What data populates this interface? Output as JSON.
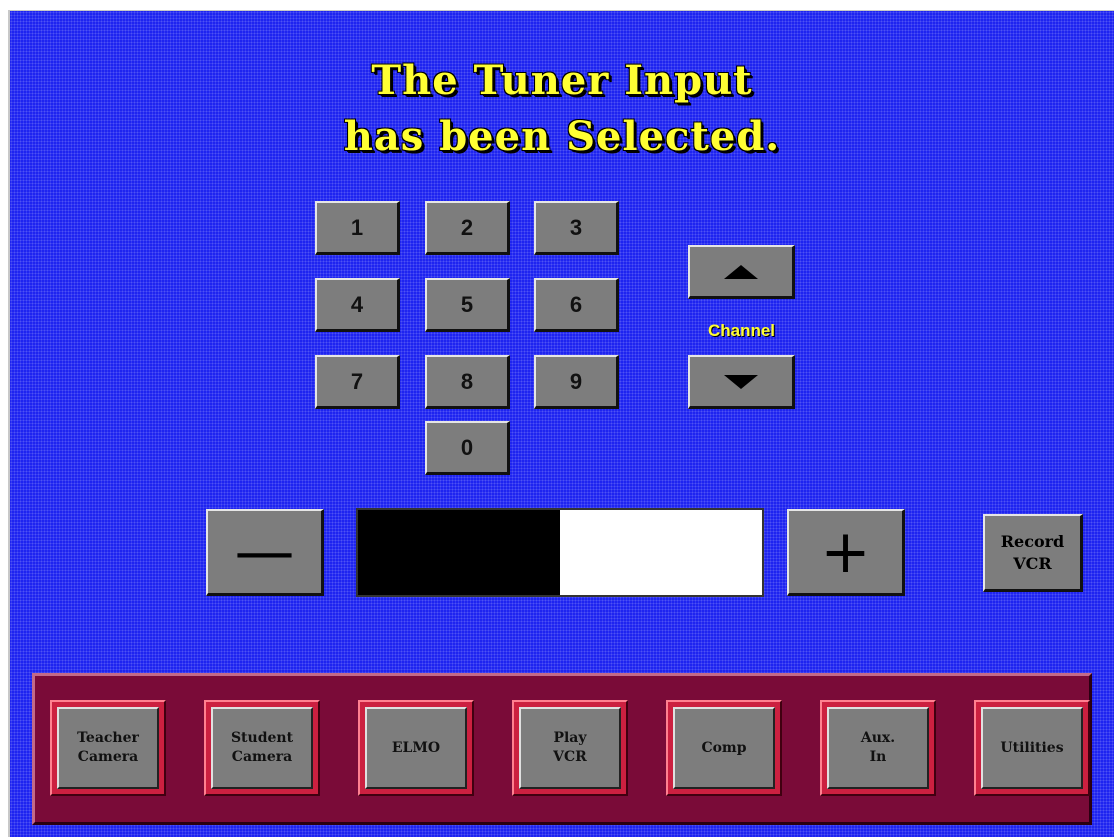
{
  "title": {
    "line1": "The Tuner Input",
    "line2": "has been Selected."
  },
  "keypad": {
    "keys": [
      "1",
      "2",
      "3",
      "4",
      "5",
      "6",
      "7",
      "8",
      "9",
      "0"
    ]
  },
  "channel": {
    "label": "Channel",
    "up_icon": "triangle-up-icon",
    "down_icon": "triangle-down-icon"
  },
  "volume": {
    "minus_label": "—",
    "plus_label": "+",
    "level": 0.5
  },
  "record": {
    "label": "Record\nVCR"
  },
  "sources": [
    {
      "label": "Teacher\nCamera"
    },
    {
      "label": "Student\nCamera"
    },
    {
      "label": "ELMO"
    },
    {
      "label": "Play\nVCR"
    },
    {
      "label": "Comp"
    },
    {
      "label": "Aux.\nIn"
    },
    {
      "label": "Utilities"
    }
  ],
  "colors": {
    "background": "#1c22f0",
    "title": "#ffff33",
    "panel": "#7a0b38",
    "button": "#7d7d7d"
  }
}
